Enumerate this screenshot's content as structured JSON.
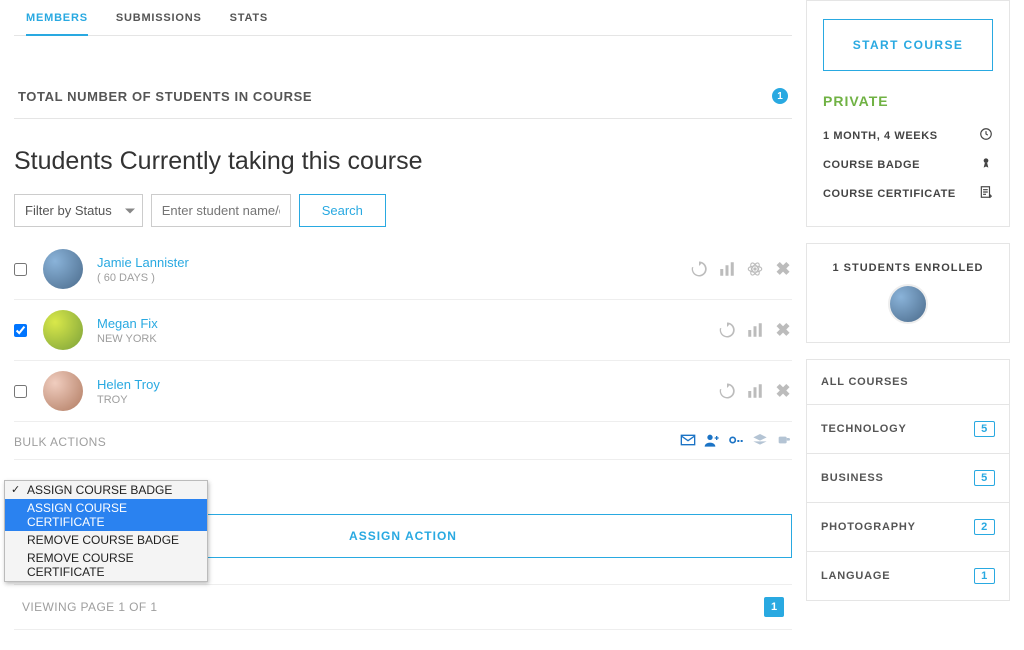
{
  "tabs": {
    "members": "MEMBERS",
    "submissions": "SUBMISSIONS",
    "stats": "STATS"
  },
  "total": {
    "label": "TOTAL NUMBER OF STUDENTS IN COURSE",
    "count": "1"
  },
  "section_title": "Students Currently taking this course",
  "filter": {
    "status_label": "Filter by Status",
    "placeholder": "Enter student name/em",
    "search_label": "Search"
  },
  "students": [
    {
      "name": "Jamie Lannister",
      "meta": "( 60 DAYS )",
      "checked": false,
      "actions": [
        "refresh",
        "stats",
        "atom",
        "remove"
      ]
    },
    {
      "name": "Megan Fix",
      "meta": "NEW YORK",
      "checked": true,
      "actions": [
        "refresh",
        "stats",
        "remove"
      ]
    },
    {
      "name": "Helen Troy",
      "meta": "TROY",
      "checked": false,
      "actions": [
        "refresh",
        "stats",
        "remove"
      ]
    }
  ],
  "bulk": {
    "label": "BULK ACTIONS",
    "dropdown": {
      "selected": "ASSIGN COURSE BADGE",
      "highlighted": "ASSIGN COURSE CERTIFICATE",
      "options": [
        "ASSIGN COURSE BADGE",
        "ASSIGN COURSE CERTIFICATE",
        "REMOVE COURSE BADGE",
        "REMOVE COURSE CERTIFICATE"
      ]
    },
    "assign_button": "ASSIGN ACTION"
  },
  "pager": {
    "label": "VIEWING PAGE 1 OF 1",
    "current": "1"
  },
  "sidebar": {
    "start_button": "START COURSE",
    "privacy": "PRIVATE",
    "info": {
      "duration": "1 MONTH, 4 WEEKS",
      "badge": "COURSE BADGE",
      "certificate": "COURSE CERTIFICATE"
    },
    "enrolled_label": "1 STUDENTS ENROLLED",
    "categories": {
      "all": "ALL COURSES",
      "items": [
        {
          "label": "TECHNOLOGY",
          "count": "5"
        },
        {
          "label": "BUSINESS",
          "count": "5"
        },
        {
          "label": "PHOTOGRAPHY",
          "count": "2"
        },
        {
          "label": "LANGUAGE",
          "count": "1"
        }
      ]
    }
  }
}
